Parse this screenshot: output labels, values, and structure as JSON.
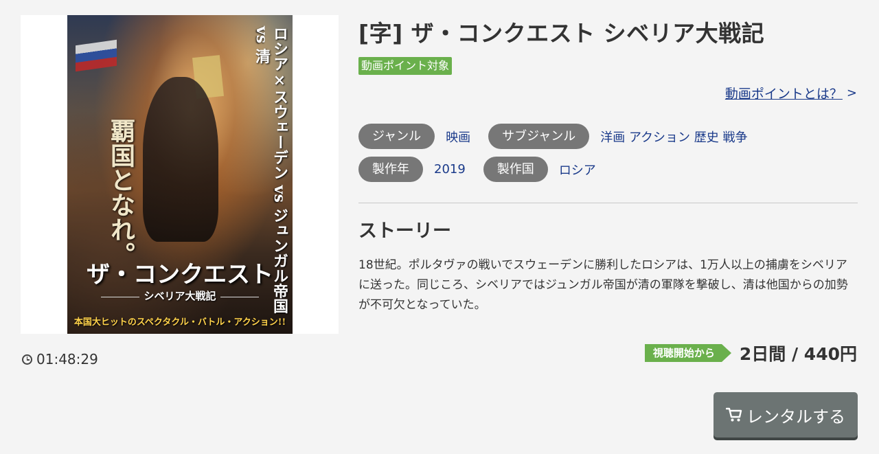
{
  "poster": {
    "vertical_right": "ロシア×スウェーデン vs ジュンガル帝国 vs 清",
    "vertical_left": "覇国となれ。",
    "title": "ザ・コンクエスト",
    "subtitle": "シベリア大戦記",
    "tagline": "本国大ヒットのスペクタクル・バトル・アクション!!"
  },
  "duration": {
    "icon": "clock-icon",
    "value": "01:48:29"
  },
  "title": "[字] ザ・コンクエスト シベリア大戦記",
  "point_badge": "動画ポイント対象",
  "point_link": {
    "label": "動画ポイントとは？",
    "chevron": ">"
  },
  "meta": {
    "genre_label": "ジャンル",
    "genre_value": "映画",
    "subgenre_label": "サブジャンル",
    "subgenres": [
      "洋画",
      "アクション",
      "歴史",
      "戦争"
    ],
    "year_label": "製作年",
    "year_value": "2019",
    "country_label": "製作国",
    "country_value": "ロシア"
  },
  "story": {
    "heading": "ストーリー",
    "text": "18世紀。ポルタヴァの戦いでスウェーデンに勝利したロシアは、1万人以上の捕虜をシベリアに送った。同じころ、シベリアではジュンガル帝国が清の軍隊を撃破し、清は他国からの加勢が不可欠となっていた。"
  },
  "price": {
    "period_badge": "視聴開始から",
    "text": "2日間 / 440円"
  },
  "rent_button": {
    "icon": "cart-icon",
    "label": "レンタルする"
  },
  "colors": {
    "accent_green": "#6ab04c",
    "link_blue": "#1a3a8a",
    "pill_gray": "#777777",
    "button_gray": "#6c7473",
    "background": "#f4f4f4"
  }
}
